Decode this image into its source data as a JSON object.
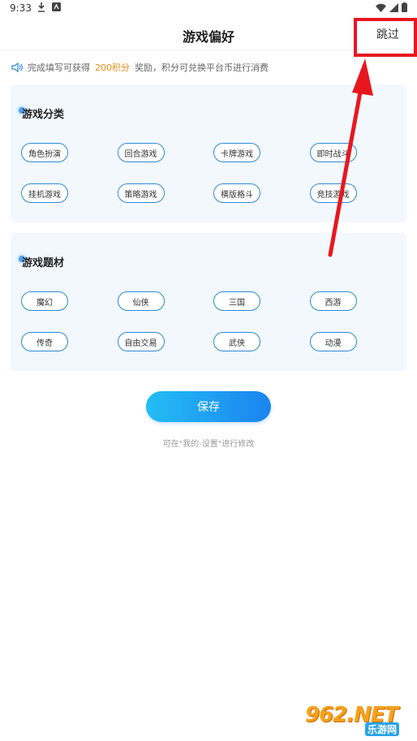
{
  "status_bar": {
    "time": "9:33"
  },
  "header": {
    "title": "游戏偏好",
    "skip_label": "跳过"
  },
  "notice": {
    "prefix": "完成填写可获得",
    "points": "200积分",
    "suffix": "奖励，积分可兑换平台币进行消费"
  },
  "sections": [
    {
      "title": "游戏分类",
      "tags": [
        "角色扮演",
        "回合游戏",
        "卡牌游戏",
        "即时战斗",
        "挂机游戏",
        "策略游戏",
        "横版格斗",
        "竞技游戏"
      ]
    },
    {
      "title": "游戏题材",
      "tags": [
        "魔幻",
        "仙侠",
        "三国",
        "西游",
        "传奇",
        "自由交易",
        "武侠",
        "动漫"
      ]
    }
  ],
  "save_label": "保存",
  "hint": "可在\"我的-设置\"进行修改",
  "watermark": {
    "logo": "962.NET",
    "sub": "乐游网"
  },
  "colors": {
    "accent": "#1c84ef",
    "tag_border": "#2c8ad6",
    "points": "#f08c1c",
    "annotation": "#e8171f",
    "card_bg": "#f2f8fe"
  }
}
